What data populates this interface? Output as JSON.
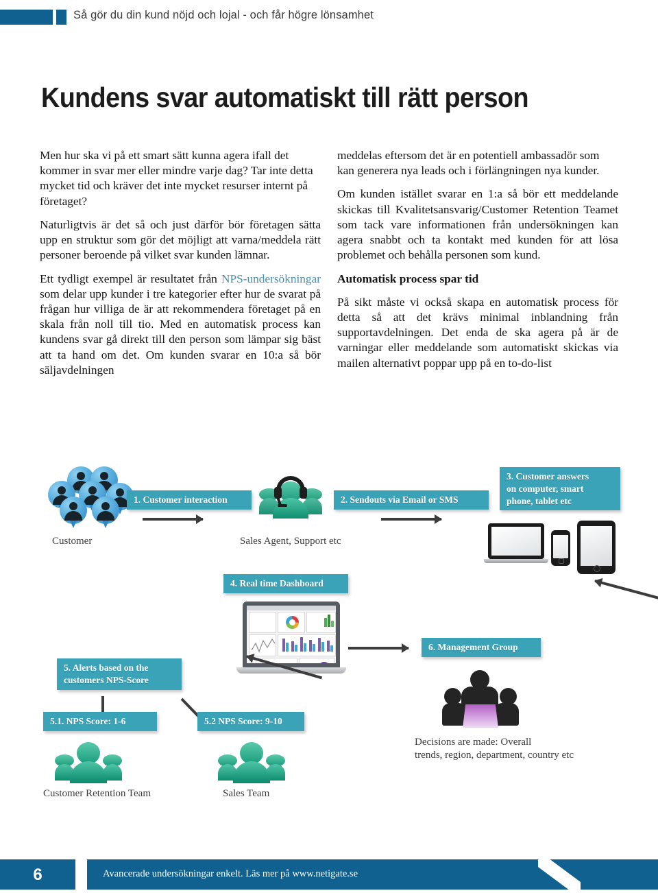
{
  "header": {
    "running_title": "Så gör du din kund nöjd och lojal - och får högre lönsamhet",
    "bar_color": "#10618f"
  },
  "title": "Kundens svar automatiskt till rätt person",
  "columns": {
    "left": [
      "Men hur ska vi på ett smart sätt kunna agera ifall det kommer in svar mer eller mindre varje dag? Tar inte detta mycket tid och kräver det inte mycket resurser internt på företaget?",
      "Naturligtvis är det så och just därför bör företagen sätta upp en struktur som gör det möjligt att varna/meddela rätt personer beroende på vilket svar kunden lämnar.",
      "Ett tydligt exempel är resultatet från ",
      "NPS-undersökningar",
      " som delar upp kunder i tre kategorier efter hur de svarat på frågan hur villiga de är att rekommendera företaget på en skala från noll till tio. Med en automatisk process kan kundens svar gå direkt till den person som lämpar sig bäst att ta hand om det. Om kunden svarar  en 10:a så bör säljavdelningen"
    ],
    "right": {
      "p1": "meddelas eftersom det är en potentiell ambassadör som kan generera nya leads och i förlängningen nya kunder.",
      "p2": "Om kunden istället svarar en 1:a så bör ett meddelande skickas till Kvalitetsansvarig/Customer Retention Teamet som tack vare informationen från undersökningen kan agera snabbt och ta kontakt med kunden för att lösa problemet och behålla personen som kund.",
      "subhead": "Automatisk process spar tid",
      "p3": "På sikt måste vi också skapa en automatisk process för detta så att det krävs minimal inblandning från supportavdelningen. Det enda de ska agera på är de varningar eller meddelande som automatiskt skickas via mailen alternativt poppar upp på en to-do-list"
    }
  },
  "diagram": {
    "accent_color": "#3ba3b8",
    "steps": [
      {
        "id": "step-1",
        "label": "1. Customer interaction"
      },
      {
        "id": "step-2",
        "label": "2. Sendouts via Email or SMS"
      },
      {
        "id": "step-3",
        "label": "3. Customer answers\non computer, smart\nphone, tablet etc"
      },
      {
        "id": "step-4",
        "label": "4. Real time Dashboard"
      },
      {
        "id": "step-5",
        "label": "5. Alerts based on the\ncustomers NPS-Score"
      },
      {
        "id": "step-5-1",
        "label": "5.1. NPS Score: 1-6"
      },
      {
        "id": "step-5-2",
        "label": "5.2 NPS Score: 9-10"
      },
      {
        "id": "step-6",
        "label": "6. Management Group"
      }
    ],
    "captions": {
      "customer": "Customer",
      "sales_agent": "Sales Agent, Support etc",
      "customer_retention_team": "Customer Retention Team",
      "sales_team": "Sales Team",
      "management": "Decisions are made: Overall\ntrends, region, department, country etc"
    }
  },
  "footer": {
    "page_number": "6",
    "text": "Avancerade undersökningar enkelt. Läs mer på www.netigate.se",
    "bar_color": "#10618f"
  }
}
